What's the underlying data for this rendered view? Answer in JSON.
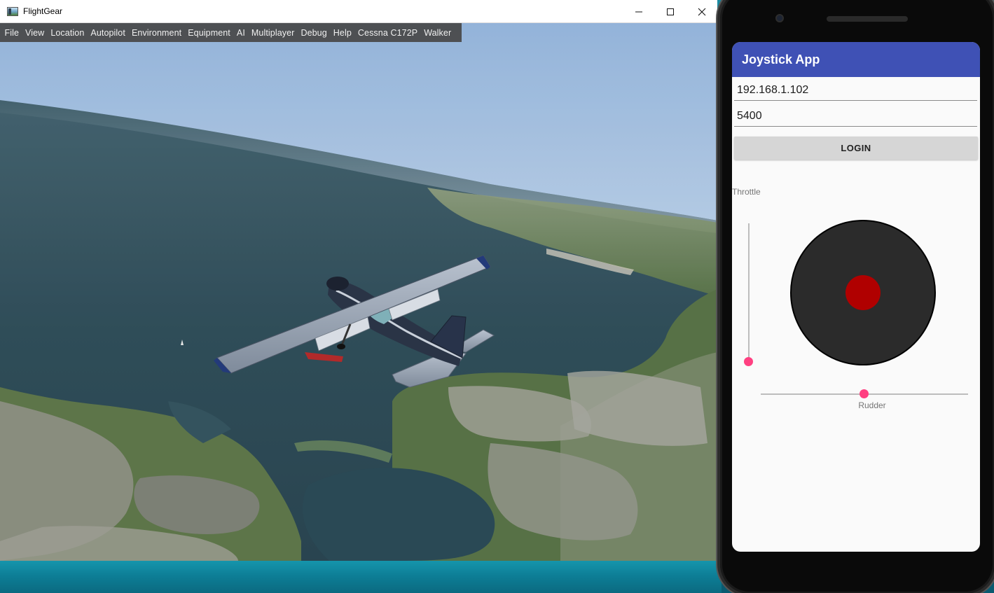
{
  "flightgear": {
    "window_title": "FlightGear",
    "menu": [
      "File",
      "View",
      "Location",
      "Autopilot",
      "Environment",
      "Equipment",
      "AI",
      "Multiplayer",
      "Debug",
      "Help",
      "Cessna C172P",
      "Walker"
    ]
  },
  "window_controls": {
    "minimize_icon": "minimize-icon",
    "maximize_icon": "maximize-icon",
    "close_icon": "close-icon"
  },
  "phone_app": {
    "title": "Joystick App",
    "ip_value": "192.168.1.102",
    "port_value": "5400",
    "login_label": "LOGIN",
    "throttle_label": "Throttle",
    "rudder_label": "Rudder",
    "throttle_level": 0.0,
    "rudder_level": 0.5
  },
  "colors": {
    "app_bar": "#3f51b5",
    "slider_accent": "#ff4081",
    "joystick_base": "#2b2b2b",
    "joystick_knob": "#b00000"
  }
}
